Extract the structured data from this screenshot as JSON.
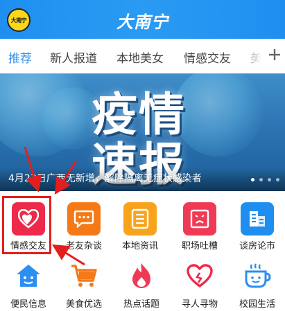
{
  "header": {
    "logo_text": "大南宁",
    "title": "大南宁"
  },
  "tabs": [
    {
      "label": "推荐",
      "active": true
    },
    {
      "label": "新人报道",
      "active": false
    },
    {
      "label": "本地美女",
      "active": false
    },
    {
      "label": "情感交友",
      "active": false
    },
    {
      "label": "美",
      "active": false
    }
  ],
  "banner": {
    "headline_line1": "疫情",
    "headline_line2": "速报",
    "caption": "4月23日广西无新增，解除隔离无症状感染者",
    "slide_count": 4,
    "active_slide": 1
  },
  "grid": {
    "row1": [
      {
        "label": "情感交友",
        "icon": "hearts-icon",
        "color": "#ee2a4b"
      },
      {
        "label": "老友杂谈",
        "icon": "chat-bubble-icon",
        "color": "#f57a17"
      },
      {
        "label": "本地资讯",
        "icon": "news-list-icon",
        "color": "#f9a31d"
      },
      {
        "label": "职场吐槽",
        "icon": "sad-face-icon",
        "color": "#f03a55"
      },
      {
        "label": "谈房论市",
        "icon": "building-icon",
        "color": "#1e8ff0"
      }
    ],
    "row2": [
      {
        "label": "便民信息",
        "icon": "house-smile-icon",
        "color": "#2c8ef0"
      },
      {
        "label": "美食优选",
        "icon": "shopping-cart-icon",
        "color": "#f57a17"
      },
      {
        "label": "热点话题",
        "icon": "flame-icon",
        "color": "#f03a55"
      },
      {
        "label": "寻人寻物",
        "icon": "heart-outline-icon",
        "color": "#ee2a4b"
      },
      {
        "label": "校园生活",
        "icon": "coffee-cup-icon",
        "color": "#2c8ef0"
      }
    ]
  },
  "annotation_color": "#e51d1d"
}
